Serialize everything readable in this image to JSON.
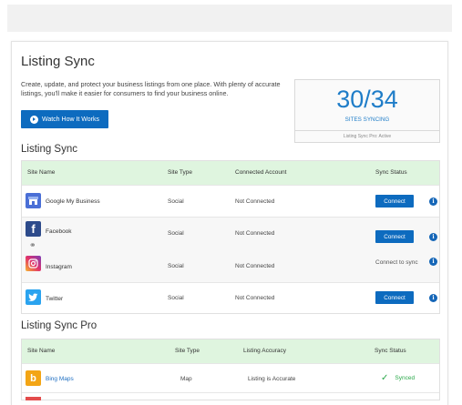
{
  "header": {
    "title": "Listing Sync",
    "description": "Create, update, and protect your business listings from one place. With plenty of accurate listings, you'll make it easier for consumers to find your business online.",
    "watch_button": "Watch How It Works"
  },
  "sync_summary": {
    "count": "30/34",
    "label": "SITES SYNCING",
    "footer": "Listing Sync Pro: Active"
  },
  "listing_sync": {
    "heading": "Listing Sync",
    "columns": [
      "Site Name",
      "Site Type",
      "Connected Account",
      "Sync Status"
    ],
    "rows": [
      {
        "site": "Google My Business",
        "type": "Social",
        "account": "Not Connected",
        "status": "Connect",
        "icon": "google-my-business-icon",
        "color": "#4a6fd6"
      },
      {
        "site": "Facebook",
        "type": "Social",
        "account": "Not Connected",
        "status": "Connect",
        "icon": "facebook-icon",
        "color": "#2d4b8b"
      },
      {
        "site": "Instagram",
        "type": "Social",
        "account": "Not Connected",
        "status": "Connect to sync",
        "icon": "instagram-icon",
        "color": "#d6367a"
      },
      {
        "site": "Twitter",
        "type": "Social",
        "account": "Not Connected",
        "status": "Connect",
        "icon": "twitter-icon",
        "color": "#2aa3ef"
      }
    ]
  },
  "listing_sync_pro": {
    "heading": "Listing Sync Pro",
    "columns": [
      "Site Name",
      "Site Type",
      "Listing Accuracy",
      "Sync Status"
    ],
    "rows": [
      {
        "site": "Bing Maps",
        "type": "Map",
        "accuracy": "Listing is Accurate",
        "status": "Synced",
        "icon": "bing-icon",
        "color": "#f3a515"
      }
    ]
  },
  "colors": {
    "primary_button": "#0d6bbf",
    "accent_text": "#1f7dc8",
    "table_header": "#dff5df",
    "synced": "#2aa84a"
  }
}
